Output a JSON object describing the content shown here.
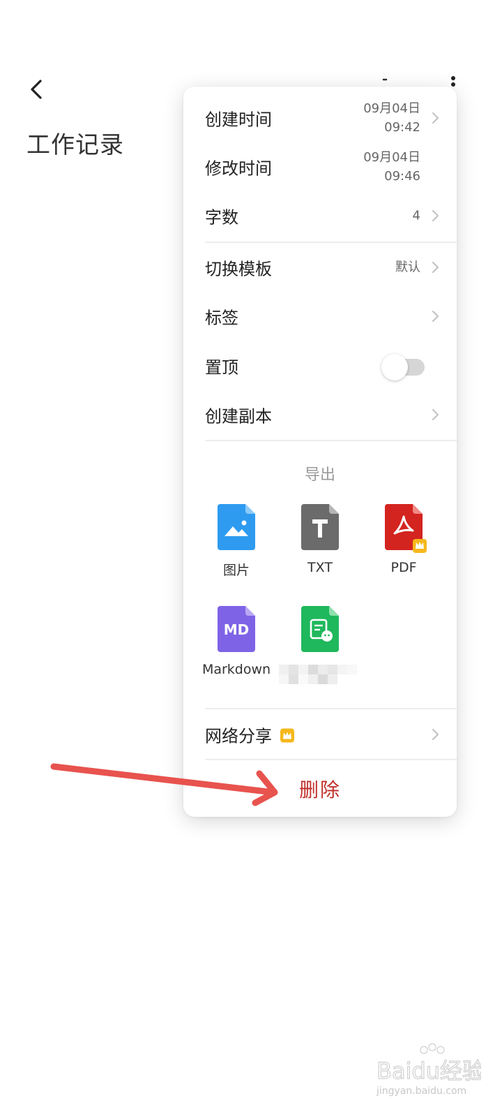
{
  "note": {
    "title": "工作记录"
  },
  "menu": {
    "info": [
      {
        "label": "创建时间",
        "date": "09月04日",
        "time": "09:42"
      },
      {
        "label": "修改时间",
        "date": "09月04日",
        "time": "09:46"
      },
      {
        "label": "字数",
        "value": "4"
      }
    ],
    "template": {
      "label": "切换模板",
      "value": "默认"
    },
    "tags": {
      "label": "标签"
    },
    "pin": {
      "label": "置顶",
      "enabled": false
    },
    "duplicate": {
      "label": "创建副本"
    },
    "export": {
      "title": "导出",
      "items": [
        {
          "label": "图片",
          "icon": "image-file-icon",
          "color": "#2E9BF0"
        },
        {
          "label": "TXT",
          "icon": "txt-file-icon",
          "color": "#6B6B6B"
        },
        {
          "label": "PDF",
          "icon": "pdf-file-icon",
          "color": "#D32420",
          "premium": true
        },
        {
          "label": "Markdown",
          "icon": "markdown-file-icon",
          "color": "#7E63E6",
          "badge": "MD"
        },
        {
          "label": "",
          "icon": "wechat-file-icon",
          "color": "#1FB85C"
        }
      ]
    },
    "share": {
      "label": "网络分享",
      "premium": true
    },
    "delete": {
      "label": "删除",
      "color": "#c0302b"
    }
  },
  "colors": {
    "accent_red": "#c0302b",
    "premium_gold": "#F5B81C",
    "arrow": "#E8534E"
  },
  "watermark": {
    "text": "Baidu经验",
    "subtext": "jingyan.baidu.com"
  }
}
